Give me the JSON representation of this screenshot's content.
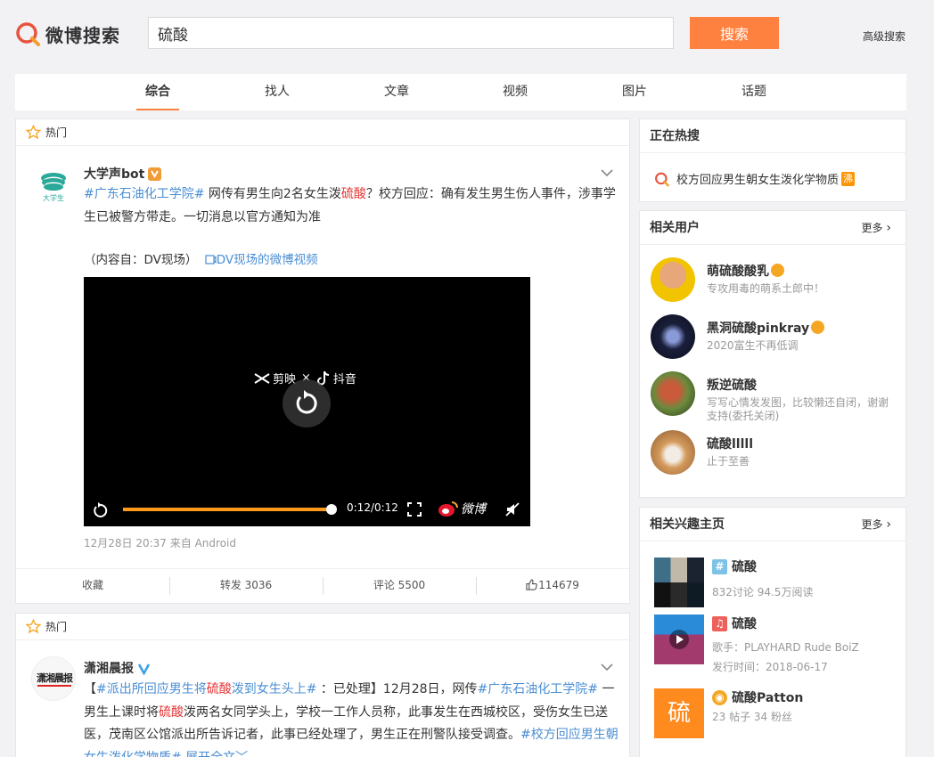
{
  "header": {
    "logo_text": "微博搜索",
    "search_value": "硫酸",
    "search_button": "搜索",
    "advanced_search": "高级搜索"
  },
  "tabs": [
    {
      "label": "综合",
      "active": true
    },
    {
      "label": "找人",
      "active": false
    },
    {
      "label": "文章",
      "active": false
    },
    {
      "label": "视频",
      "active": false
    },
    {
      "label": "图片",
      "active": false
    },
    {
      "label": "话题",
      "active": false
    }
  ],
  "posts": [
    {
      "section_label": "热门",
      "author": "大学声bot",
      "avatar_text": "大学生",
      "text_parts": [
        {
          "t": "#广东石油化工学院#",
          "k": "tag"
        },
        {
          "t": " 网传有男生向2名女生泼",
          "k": "n"
        },
        {
          "t": "硫酸",
          "k": "kw"
        },
        {
          "t": "？校方回应：确有发生男生伤人事件，涉事学生已被警方带走。一切消息以官方通知为准",
          "k": "n"
        }
      ],
      "source_prefix": "（内容自：DV现场）",
      "source_link": "DV现场的微博视频",
      "video": {
        "brand_left": "剪映",
        "brand_right": "抖音",
        "time": "0:12/0:12",
        "progress": 1.0,
        "watermark": "微博"
      },
      "meta": "12月28日 20:37  来自 Android",
      "actions": {
        "collect": "收藏",
        "repost": "转发 3036",
        "comment": "评论 5500",
        "like": "114679"
      }
    },
    {
      "section_label": "热门",
      "author": "潇湘晨报",
      "avatar_text": "潇湘晨报",
      "text_parts": [
        {
          "t": "【",
          "k": "n"
        },
        {
          "t": "#派出所回应男生将",
          "k": "tag"
        },
        {
          "t": "硫酸",
          "k": "kw"
        },
        {
          "t": "泼到女生头上#",
          "k": "tag"
        },
        {
          "t": " ：已处理】12月28日，网传",
          "k": "n"
        },
        {
          "t": "#广东石油化工学院#",
          "k": "tag"
        },
        {
          "t": " 一男生上课时将",
          "k": "n"
        },
        {
          "t": "硫酸",
          "k": "kw"
        },
        {
          "t": "泼两名女同学头上，学校一工作人员称，此事发生在西城校区，受伤女生已送医，茂南区公馆派出所告诉记者，此事已经处理了，男生正在刑警队接受调查。",
          "k": "n"
        },
        {
          "t": "#校方回应男生朝女生泼化学物质#",
          "k": "tag"
        },
        {
          "t": " 展开全文﹀",
          "k": "tag"
        }
      ]
    }
  ],
  "hot_search": {
    "title": "正在热搜",
    "item": "校方回应男生朝女生泼化学物质",
    "badge": "沸"
  },
  "related_users": {
    "title": "相关用户",
    "more": "更多",
    "items": [
      {
        "name": "萌硫酸酸乳",
        "desc": "专攻用毒的萌系土郎中！",
        "emoji": true
      },
      {
        "name": "黑洞硫酸pinkray",
        "desc": "2020富生不再低调",
        "emoji": true
      },
      {
        "name": "叛逆硫酸",
        "desc": "写写心情发发图，比较懒还自闭，谢谢支持(委托关闭)",
        "emoji": false
      },
      {
        "name": "硫酸lllll",
        "desc": "止于至善",
        "emoji": false
      }
    ]
  },
  "related_pages": {
    "title": "相关兴趣主页",
    "more": "更多",
    "items": [
      {
        "name": "硫酸",
        "icon": "#",
        "icon_color": "#7ec2e8",
        "sub1": "832讨论 94.5万阅读",
        "sub2": ""
      },
      {
        "name": "硫酸",
        "icon": "♫",
        "icon_color": "#f0605a",
        "sub1": "歌手：PLAYHARD Rude BoiZ",
        "sub2": "发行时间：2018-06-17"
      },
      {
        "name": "硫酸Patton",
        "icon": "◉",
        "icon_color": "#f5a623",
        "sub1": "23 帖子 34 粉丝",
        "sub2": "",
        "thumb_char": "硫"
      }
    ]
  },
  "colors": {
    "accent": "#ff8140",
    "link": "#4a8ed3",
    "keyword": "#e63434"
  }
}
